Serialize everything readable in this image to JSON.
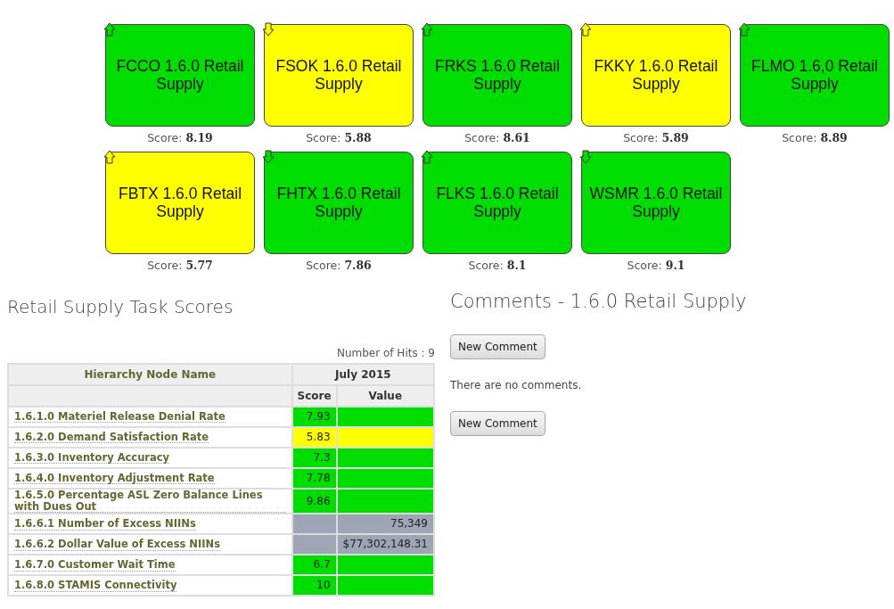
{
  "tiles": [
    {
      "title": "FCCO 1.6.0 Retail Supply",
      "color": "#00dd00",
      "rising": true,
      "score_label": "Score:",
      "score": "8.19"
    },
    {
      "title": "FSOK 1.6.0 Retail Supply",
      "color": "#ffff00",
      "rising": false,
      "score_label": "Score:",
      "score": "5.88"
    },
    {
      "title": "FRKS 1.6.0 Retail Supply",
      "color": "#00dd00",
      "rising": true,
      "score_label": "Score:",
      "score": "8.61"
    },
    {
      "title": "FKKY 1.6.0 Retail Supply",
      "color": "#ffff00",
      "rising": true,
      "score_label": "Score:",
      "score": "5.89"
    },
    {
      "title": "FLMO 1.6,0 Retail Supply",
      "color": "#00dd00",
      "rising": true,
      "score_label": "Score:",
      "score": "8.89"
    },
    {
      "title": "FBTX 1.6.0 Retail Supply",
      "color": "#ffff00",
      "rising": true,
      "score_label": "Score:",
      "score": "5.77"
    },
    {
      "title": "FHTX 1.6.0 Retail Supply",
      "color": "#00dd00",
      "rising": false,
      "score_label": "Score:",
      "score": "7.86"
    },
    {
      "title": "FLKS 1.6.0 Retail Supply",
      "color": "#00dd00",
      "rising": true,
      "score_label": "Score:",
      "score": "8.1"
    },
    {
      "title": "WSMR 1.6.0 Retail Supply",
      "color": "#00dd00",
      "rising": false,
      "score_label": "Score:",
      "score": "9.1"
    }
  ],
  "task_scores": {
    "title": "Retail Supply Task Scores",
    "hits": "Number of Hits : 9",
    "columns": {
      "name": "Hierarchy Node Name",
      "period": "July 2015",
      "score": "Score",
      "value": "Value"
    },
    "rows": [
      {
        "name": "1.6.1.0 Materiel Release Denial Rate",
        "score": "7.93",
        "color": "#00dd00"
      },
      {
        "name": "1.6.2.0 Demand Satisfaction Rate",
        "score": "5.83",
        "color": "#ffff00"
      },
      {
        "name": "1.6.3.0 Inventory Accuracy",
        "score": "7.3",
        "color": "#00dd00"
      },
      {
        "name": "1.6.4.0 Inventory Adjustment Rate",
        "score": "7.78",
        "color": "#00dd00"
      },
      {
        "name": "1.6.5.0 Percentage ASL Zero Balance Lines with Dues Out",
        "score": "9.86",
        "color": "#00dd00"
      },
      {
        "name": "1.6.6.1 Number of Excess NIINs",
        "value": "75,349",
        "color": "#9ea6b5"
      },
      {
        "name": "1.6.6.2 Dollar Value of Excess NIINs",
        "value": "$77,302,148.31",
        "color": "#9ea6b5"
      },
      {
        "name": "1.6.7.0 Customer Wait Time",
        "score": "6.7",
        "color": "#00dd00"
      },
      {
        "name": "1.6.8.0 STAMIS Connectivity",
        "score": "10",
        "color": "#00dd00"
      }
    ]
  },
  "comments": {
    "title": "Comments - 1.6.0 Retail Supply",
    "top_button": "New Comment",
    "empty_text": "There are no comments.",
    "bottom_button": "New Comment"
  }
}
